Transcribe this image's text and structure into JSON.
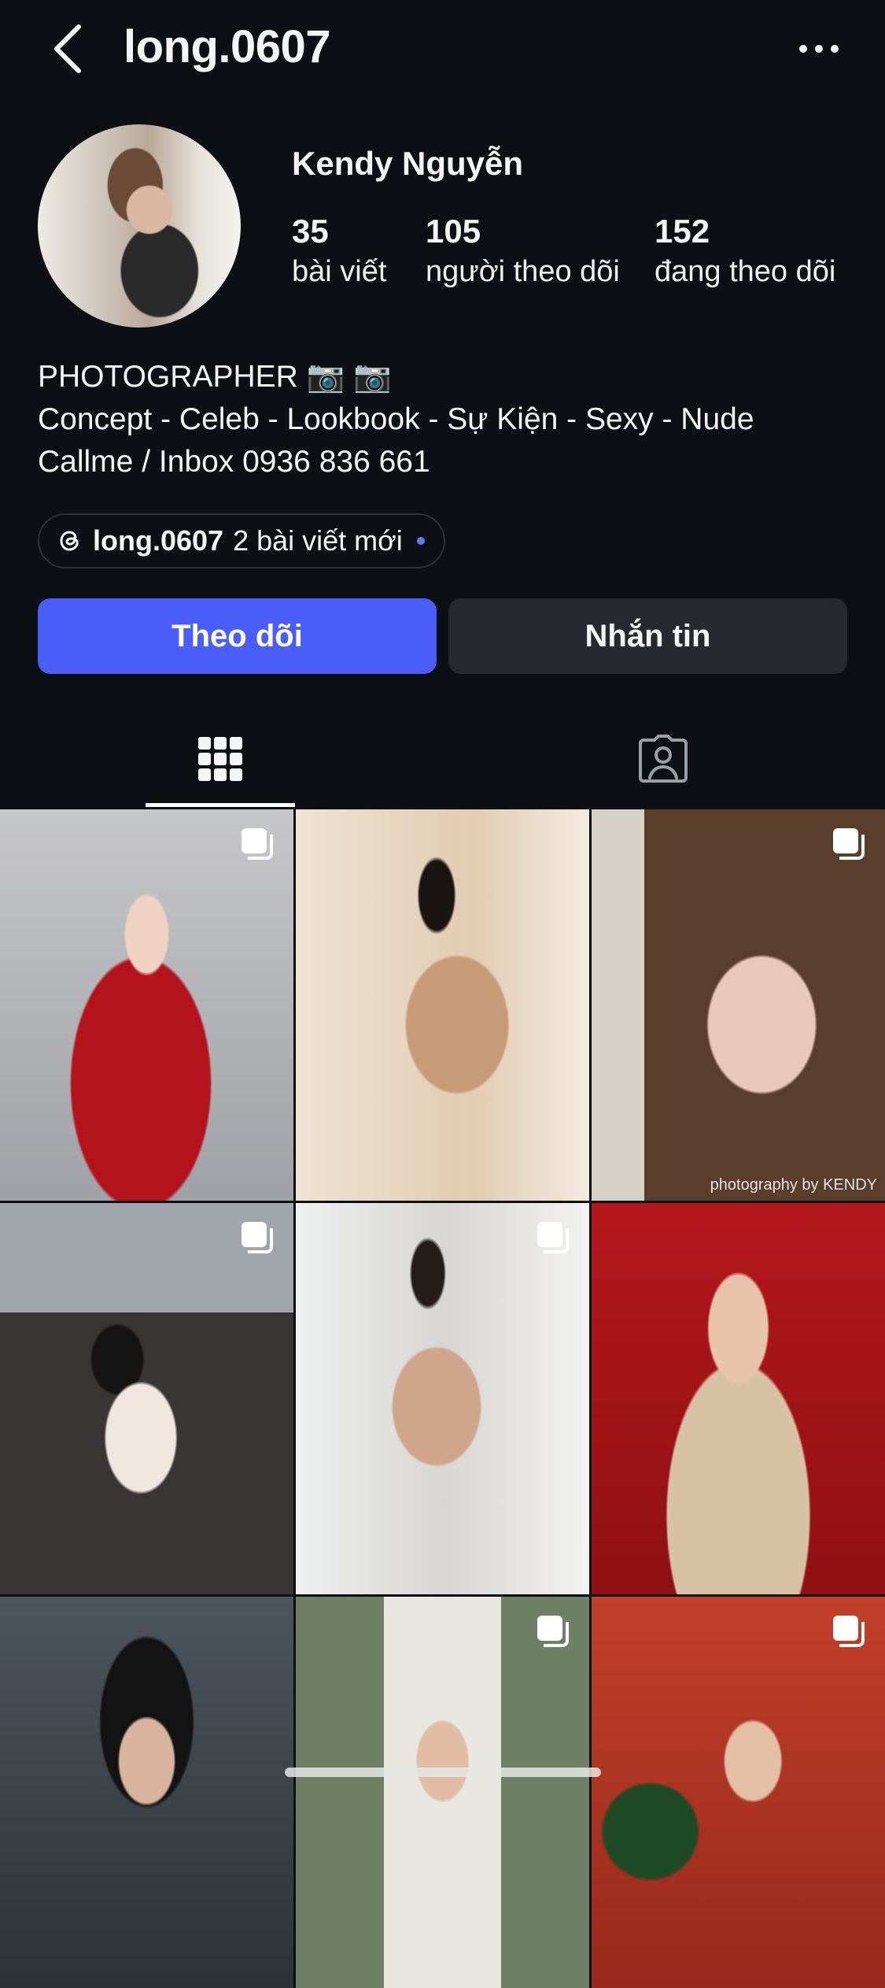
{
  "header": {
    "username": "long.0607"
  },
  "profile": {
    "display_name": "Kendy Nguyễn",
    "stats": [
      {
        "value": "35",
        "label": "bài viết"
      },
      {
        "value": "105",
        "label": "người theo dõi"
      },
      {
        "value": "152",
        "label": "đang theo dõi"
      }
    ],
    "bio": [
      "PHOTOGRAPHER 📷 📷",
      "Concept - Celeb - Lookbook - Sự Kiện - Sexy - Nude",
      "Callme / Inbox 0936 836 661"
    ],
    "threads_pill": {
      "username": "long.0607",
      "text": "2 bài viết mới"
    }
  },
  "actions": {
    "follow_label": "Theo dõi",
    "message_label": "Nhắn tin"
  },
  "tabs": [
    {
      "icon": "grid-icon",
      "active": true
    },
    {
      "icon": "tagged-person-icon",
      "active": false
    }
  ],
  "grid": {
    "watermarks": [
      "photography by KENDY"
    ]
  }
}
